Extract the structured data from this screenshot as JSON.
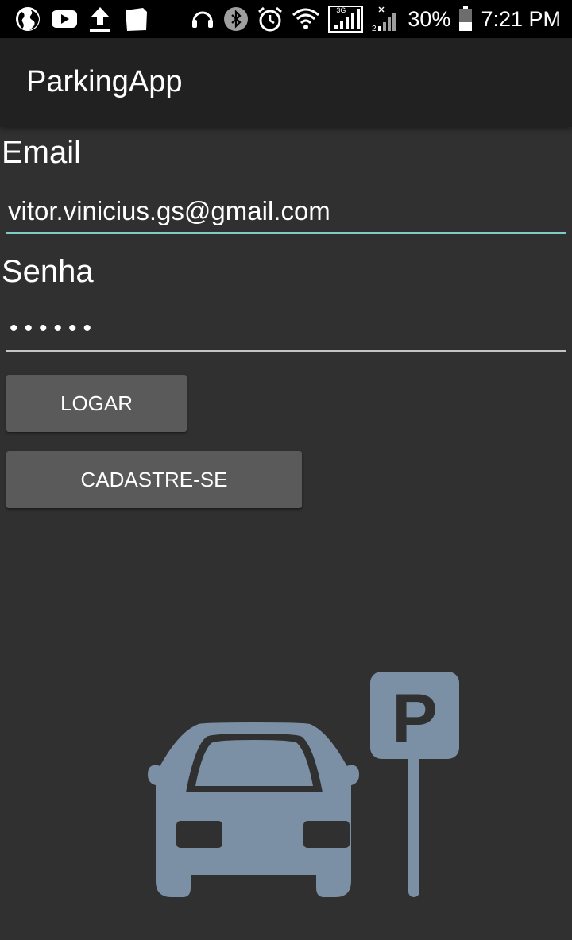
{
  "status_bar": {
    "left_icons": [
      "globe-icon",
      "youtube-icon",
      "upload-icon",
      "notes-icon"
    ],
    "right_icons": [
      "headset-icon",
      "bluetooth-icon",
      "alarm-icon",
      "wifi-icon",
      "signal-3g-icon",
      "signal-2-icon"
    ],
    "network_label": "3G",
    "battery_percent": "30%",
    "time": "7:21 PM"
  },
  "app_bar": {
    "title": "ParkingApp"
  },
  "form": {
    "email_label": "Email",
    "email_value": "vitor.vinicius.gs@gmail.com",
    "password_label": "Senha",
    "password_value": "••••••",
    "login_button": "LOGAR",
    "register_button": "CADASTRE-SE"
  },
  "logo": {
    "icon": "car-parking-icon",
    "sign_letter": "P"
  },
  "colors": {
    "background": "#303030",
    "app_bar": "#212121",
    "accent": "#80CBC4",
    "button": "#5a5a5a",
    "logo": "#7b90a5"
  }
}
